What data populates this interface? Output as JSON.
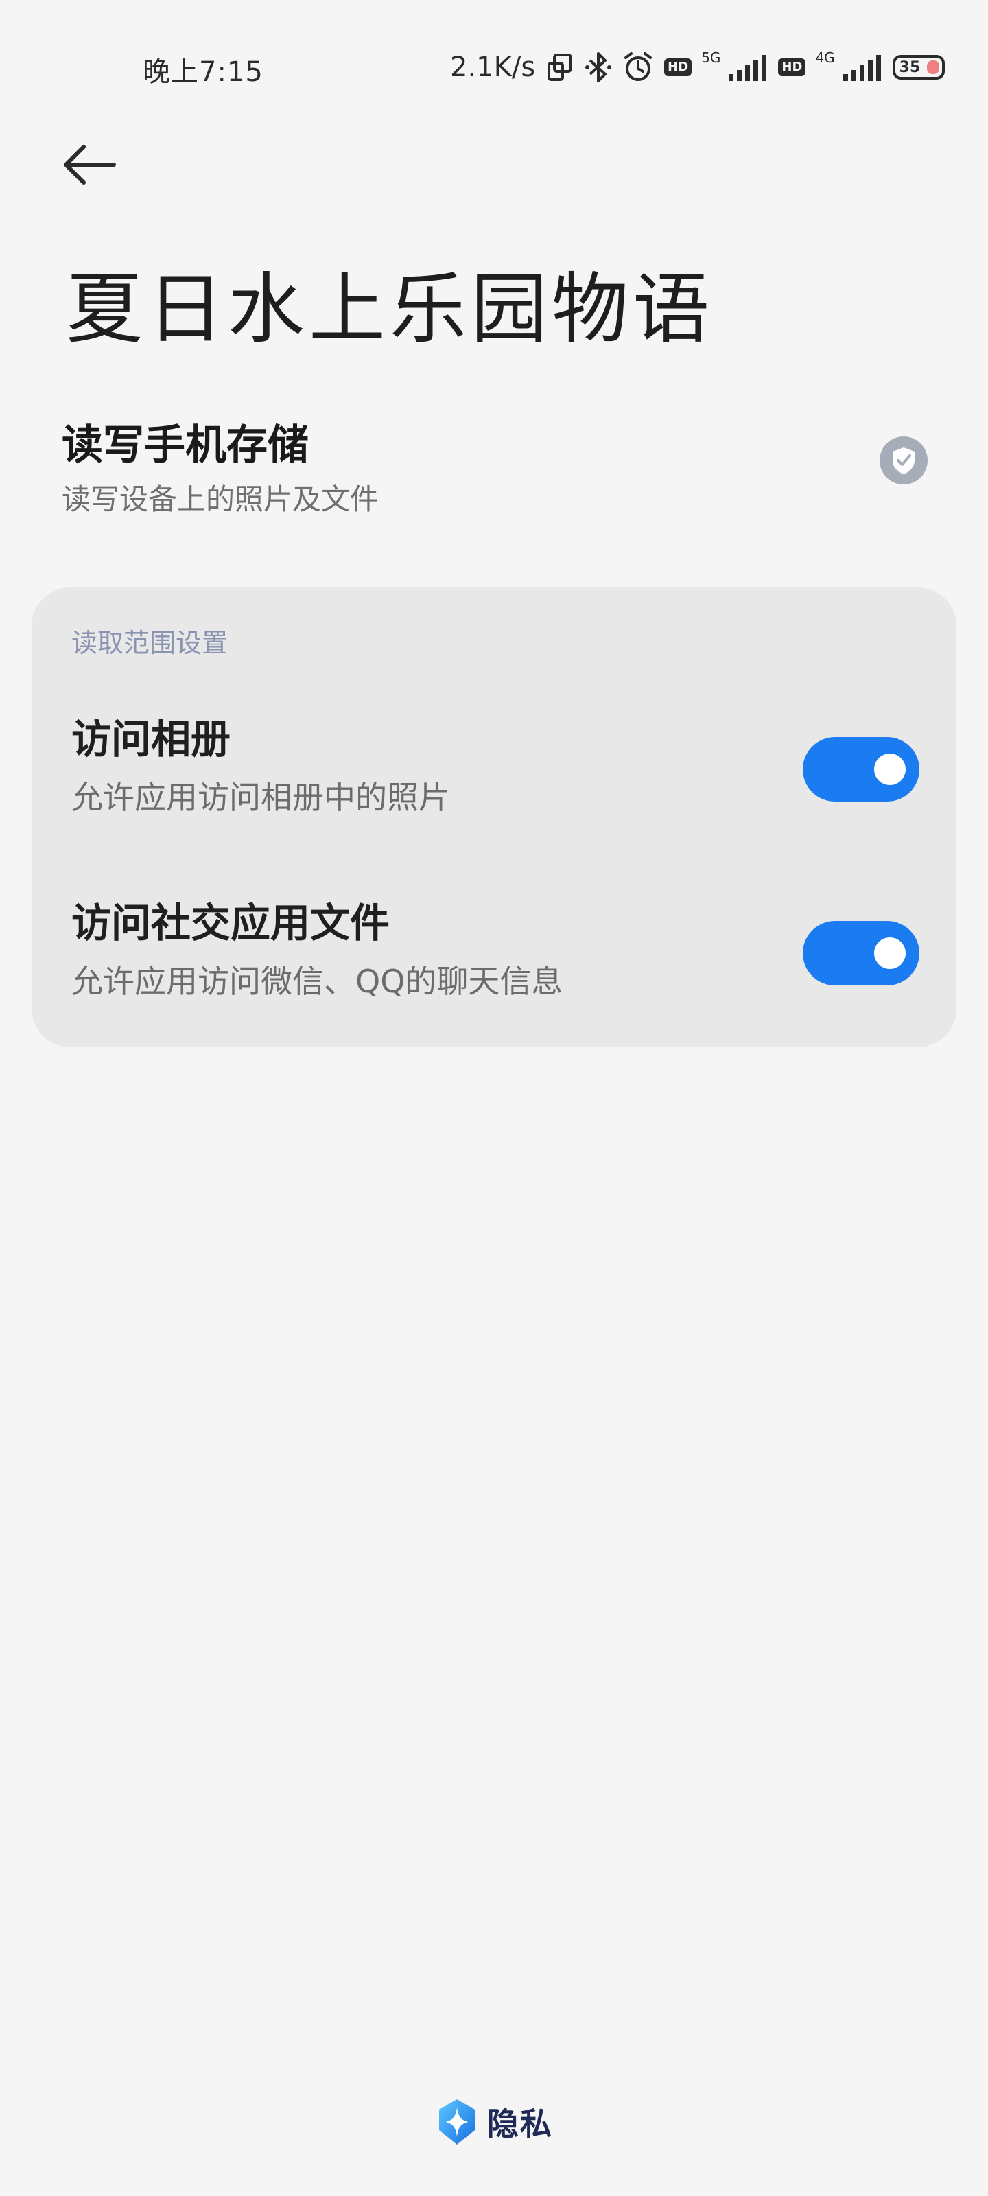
{
  "status_bar": {
    "time": "晚上7:15",
    "net_speed": "2.1K/s",
    "hd_badge_1": "HD",
    "network_1": "5G",
    "hd_badge_2": "HD",
    "network_2": "4G",
    "battery_level": "35",
    "battery_color": "#f08080"
  },
  "header": {
    "back_icon": "arrow-left-icon",
    "title": "夏日水上乐园物语"
  },
  "permission": {
    "title": "读写手机存储",
    "subtitle": "读写设备上的照片及文件",
    "status_icon": "shield-check-icon"
  },
  "scope_card": {
    "header": "读取范围设置",
    "settings": [
      {
        "title": "访问相册",
        "subtitle": "允许应用访问相册中的照片",
        "enabled": true
      },
      {
        "title": "访问社交应用文件",
        "subtitle": "允许应用访问微信、QQ的聊天信息",
        "enabled": true
      }
    ]
  },
  "footer": {
    "brand_icon": "privacy-shield-icon",
    "brand_label": "隐私"
  },
  "colors": {
    "accent": "#1a7cf0",
    "card_header": "#8a93b0",
    "background": "#f5f5f5"
  }
}
